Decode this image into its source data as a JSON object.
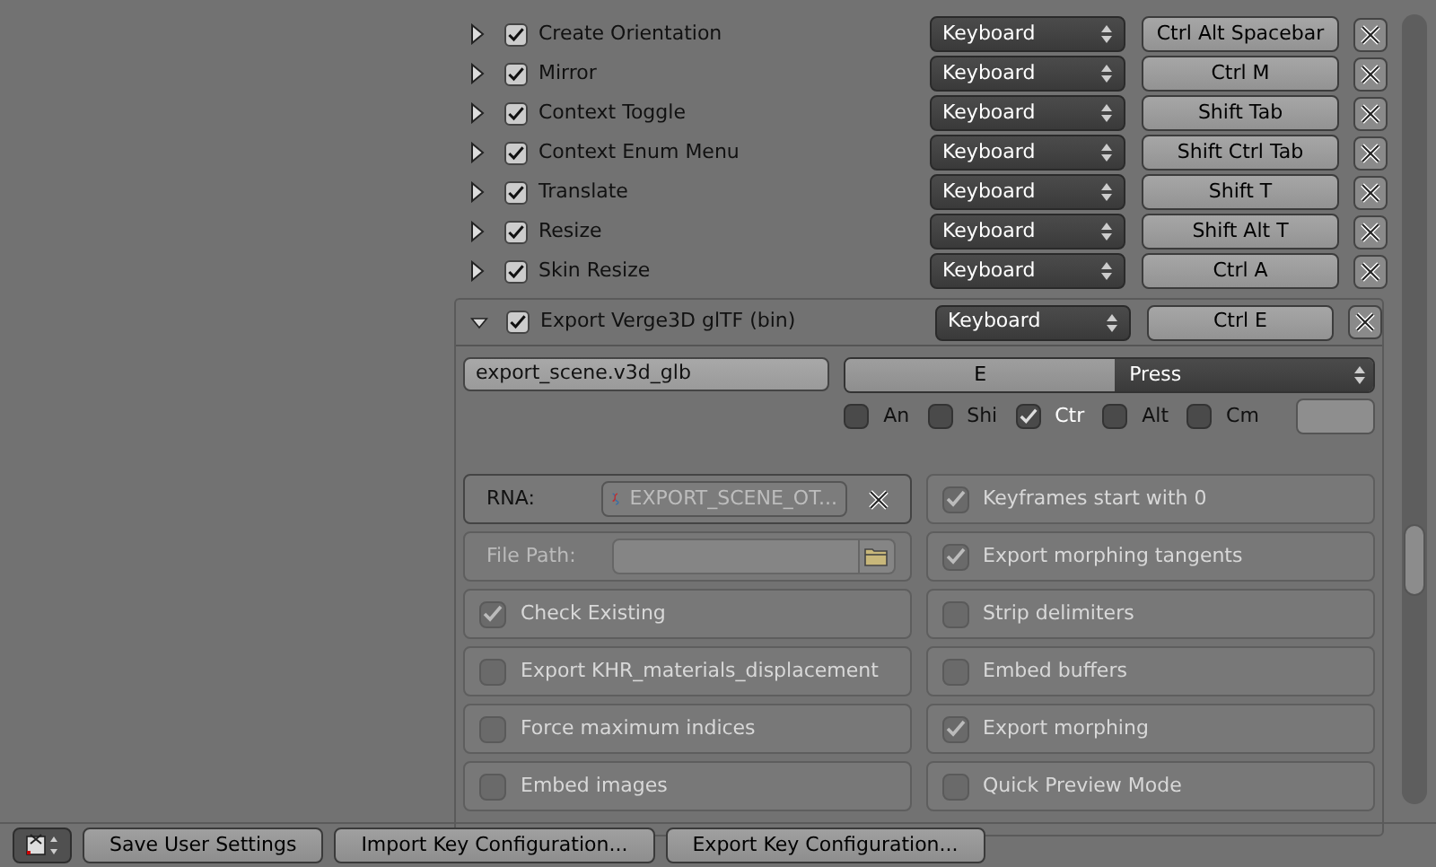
{
  "keymap_items": [
    {
      "name": "Create Orientation",
      "expanded": false,
      "active": true,
      "input_type": "Keyboard",
      "shortcut": "Ctrl Alt Spacebar"
    },
    {
      "name": "Mirror",
      "expanded": false,
      "active": true,
      "input_type": "Keyboard",
      "shortcut": "Ctrl M"
    },
    {
      "name": "Context Toggle",
      "expanded": false,
      "active": true,
      "input_type": "Keyboard",
      "shortcut": "Shift Tab"
    },
    {
      "name": "Context Enum Menu",
      "expanded": false,
      "active": true,
      "input_type": "Keyboard",
      "shortcut": "Shift Ctrl Tab"
    },
    {
      "name": "Translate",
      "expanded": false,
      "active": true,
      "input_type": "Keyboard",
      "shortcut": "Shift T"
    },
    {
      "name": "Resize",
      "expanded": false,
      "active": true,
      "input_type": "Keyboard",
      "shortcut": "Shift Alt T"
    },
    {
      "name": "Skin Resize",
      "expanded": false,
      "active": true,
      "input_type": "Keyboard",
      "shortcut": "Ctrl A"
    }
  ],
  "expanded_item": {
    "name": "Export Verge3D glTF (bin)",
    "expanded": true,
    "active": true,
    "input_type": "Keyboard",
    "shortcut": "Ctrl E",
    "operator": "export_scene.v3d_glb",
    "key": "E",
    "event": "Press",
    "modifiers": [
      {
        "label": "An",
        "checked": false
      },
      {
        "label": "Shi",
        "checked": false
      },
      {
        "label": "Ctr",
        "checked": true
      },
      {
        "label": "Alt",
        "checked": false
      },
      {
        "label": "Cm",
        "checked": false
      }
    ],
    "options_left": [
      {
        "kind": "rna",
        "label": "RNA:",
        "value": "EXPORT_SCENE_OT..."
      },
      {
        "kind": "filepath",
        "label": "File Path:"
      },
      {
        "kind": "checkbox",
        "label": "Check Existing",
        "checked": true
      },
      {
        "kind": "checkbox",
        "label": "Export KHR_materials_displacement",
        "checked": false
      },
      {
        "kind": "checkbox",
        "label": "Force maximum indices",
        "checked": false
      },
      {
        "kind": "checkbox",
        "label": "Embed images",
        "checked": false
      }
    ],
    "options_right": [
      {
        "kind": "checkbox",
        "label": "Keyframes start with 0",
        "checked": true
      },
      {
        "kind": "checkbox",
        "label": "Export morphing tangents",
        "checked": true
      },
      {
        "kind": "checkbox",
        "label": "Strip delimiters",
        "checked": false
      },
      {
        "kind": "checkbox",
        "label": "Embed buffers",
        "checked": false
      },
      {
        "kind": "checkbox",
        "label": "Export morphing",
        "checked": true
      },
      {
        "kind": "checkbox",
        "label": "Quick Preview Mode",
        "checked": false
      }
    ]
  },
  "footer_buttons": [
    "Save User Settings",
    "Import Key Configuration...",
    "Export Key Configuration..."
  ]
}
